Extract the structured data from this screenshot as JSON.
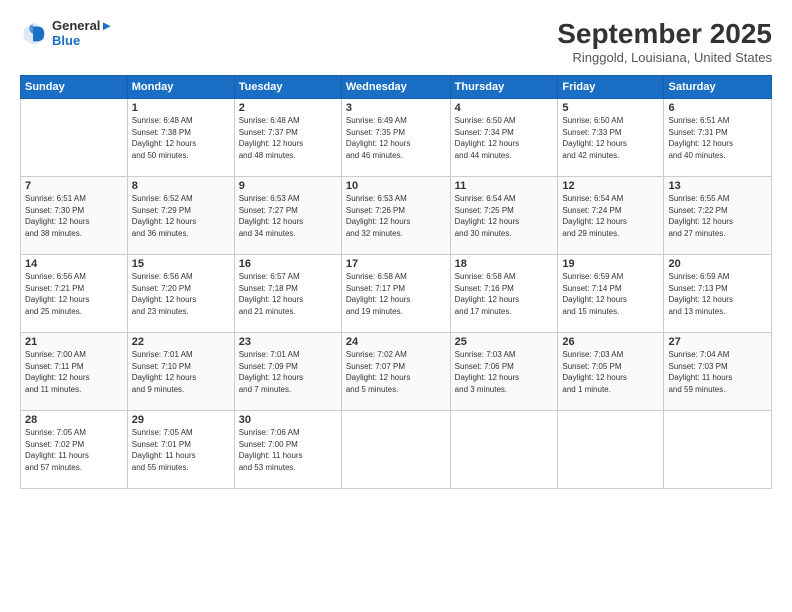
{
  "header": {
    "logo_line1": "General",
    "logo_line2": "Blue",
    "month": "September 2025",
    "location": "Ringgold, Louisiana, United States"
  },
  "weekdays": [
    "Sunday",
    "Monday",
    "Tuesday",
    "Wednesday",
    "Thursday",
    "Friday",
    "Saturday"
  ],
  "weeks": [
    [
      {
        "day": "",
        "info": ""
      },
      {
        "day": "1",
        "info": "Sunrise: 6:48 AM\nSunset: 7:38 PM\nDaylight: 12 hours\nand 50 minutes."
      },
      {
        "day": "2",
        "info": "Sunrise: 6:48 AM\nSunset: 7:37 PM\nDaylight: 12 hours\nand 48 minutes."
      },
      {
        "day": "3",
        "info": "Sunrise: 6:49 AM\nSunset: 7:35 PM\nDaylight: 12 hours\nand 46 minutes."
      },
      {
        "day": "4",
        "info": "Sunrise: 6:50 AM\nSunset: 7:34 PM\nDaylight: 12 hours\nand 44 minutes."
      },
      {
        "day": "5",
        "info": "Sunrise: 6:50 AM\nSunset: 7:33 PM\nDaylight: 12 hours\nand 42 minutes."
      },
      {
        "day": "6",
        "info": "Sunrise: 6:51 AM\nSunset: 7:31 PM\nDaylight: 12 hours\nand 40 minutes."
      }
    ],
    [
      {
        "day": "7",
        "info": "Sunrise: 6:51 AM\nSunset: 7:30 PM\nDaylight: 12 hours\nand 38 minutes."
      },
      {
        "day": "8",
        "info": "Sunrise: 6:52 AM\nSunset: 7:29 PM\nDaylight: 12 hours\nand 36 minutes."
      },
      {
        "day": "9",
        "info": "Sunrise: 6:53 AM\nSunset: 7:27 PM\nDaylight: 12 hours\nand 34 minutes."
      },
      {
        "day": "10",
        "info": "Sunrise: 6:53 AM\nSunset: 7:26 PM\nDaylight: 12 hours\nand 32 minutes."
      },
      {
        "day": "11",
        "info": "Sunrise: 6:54 AM\nSunset: 7:25 PM\nDaylight: 12 hours\nand 30 minutes."
      },
      {
        "day": "12",
        "info": "Sunrise: 6:54 AM\nSunset: 7:24 PM\nDaylight: 12 hours\nand 29 minutes."
      },
      {
        "day": "13",
        "info": "Sunrise: 6:55 AM\nSunset: 7:22 PM\nDaylight: 12 hours\nand 27 minutes."
      }
    ],
    [
      {
        "day": "14",
        "info": "Sunrise: 6:56 AM\nSunset: 7:21 PM\nDaylight: 12 hours\nand 25 minutes."
      },
      {
        "day": "15",
        "info": "Sunrise: 6:56 AM\nSunset: 7:20 PM\nDaylight: 12 hours\nand 23 minutes."
      },
      {
        "day": "16",
        "info": "Sunrise: 6:57 AM\nSunset: 7:18 PM\nDaylight: 12 hours\nand 21 minutes."
      },
      {
        "day": "17",
        "info": "Sunrise: 6:58 AM\nSunset: 7:17 PM\nDaylight: 12 hours\nand 19 minutes."
      },
      {
        "day": "18",
        "info": "Sunrise: 6:58 AM\nSunset: 7:16 PM\nDaylight: 12 hours\nand 17 minutes."
      },
      {
        "day": "19",
        "info": "Sunrise: 6:59 AM\nSunset: 7:14 PM\nDaylight: 12 hours\nand 15 minutes."
      },
      {
        "day": "20",
        "info": "Sunrise: 6:59 AM\nSunset: 7:13 PM\nDaylight: 12 hours\nand 13 minutes."
      }
    ],
    [
      {
        "day": "21",
        "info": "Sunrise: 7:00 AM\nSunset: 7:11 PM\nDaylight: 12 hours\nand 11 minutes."
      },
      {
        "day": "22",
        "info": "Sunrise: 7:01 AM\nSunset: 7:10 PM\nDaylight: 12 hours\nand 9 minutes."
      },
      {
        "day": "23",
        "info": "Sunrise: 7:01 AM\nSunset: 7:09 PM\nDaylight: 12 hours\nand 7 minutes."
      },
      {
        "day": "24",
        "info": "Sunrise: 7:02 AM\nSunset: 7:07 PM\nDaylight: 12 hours\nand 5 minutes."
      },
      {
        "day": "25",
        "info": "Sunrise: 7:03 AM\nSunset: 7:06 PM\nDaylight: 12 hours\nand 3 minutes."
      },
      {
        "day": "26",
        "info": "Sunrise: 7:03 AM\nSunset: 7:05 PM\nDaylight: 12 hours\nand 1 minute."
      },
      {
        "day": "27",
        "info": "Sunrise: 7:04 AM\nSunset: 7:03 PM\nDaylight: 11 hours\nand 59 minutes."
      }
    ],
    [
      {
        "day": "28",
        "info": "Sunrise: 7:05 AM\nSunset: 7:02 PM\nDaylight: 11 hours\nand 57 minutes."
      },
      {
        "day": "29",
        "info": "Sunrise: 7:05 AM\nSunset: 7:01 PM\nDaylight: 11 hours\nand 55 minutes."
      },
      {
        "day": "30",
        "info": "Sunrise: 7:06 AM\nSunset: 7:00 PM\nDaylight: 11 hours\nand 53 minutes."
      },
      {
        "day": "",
        "info": ""
      },
      {
        "day": "",
        "info": ""
      },
      {
        "day": "",
        "info": ""
      },
      {
        "day": "",
        "info": ""
      }
    ]
  ]
}
